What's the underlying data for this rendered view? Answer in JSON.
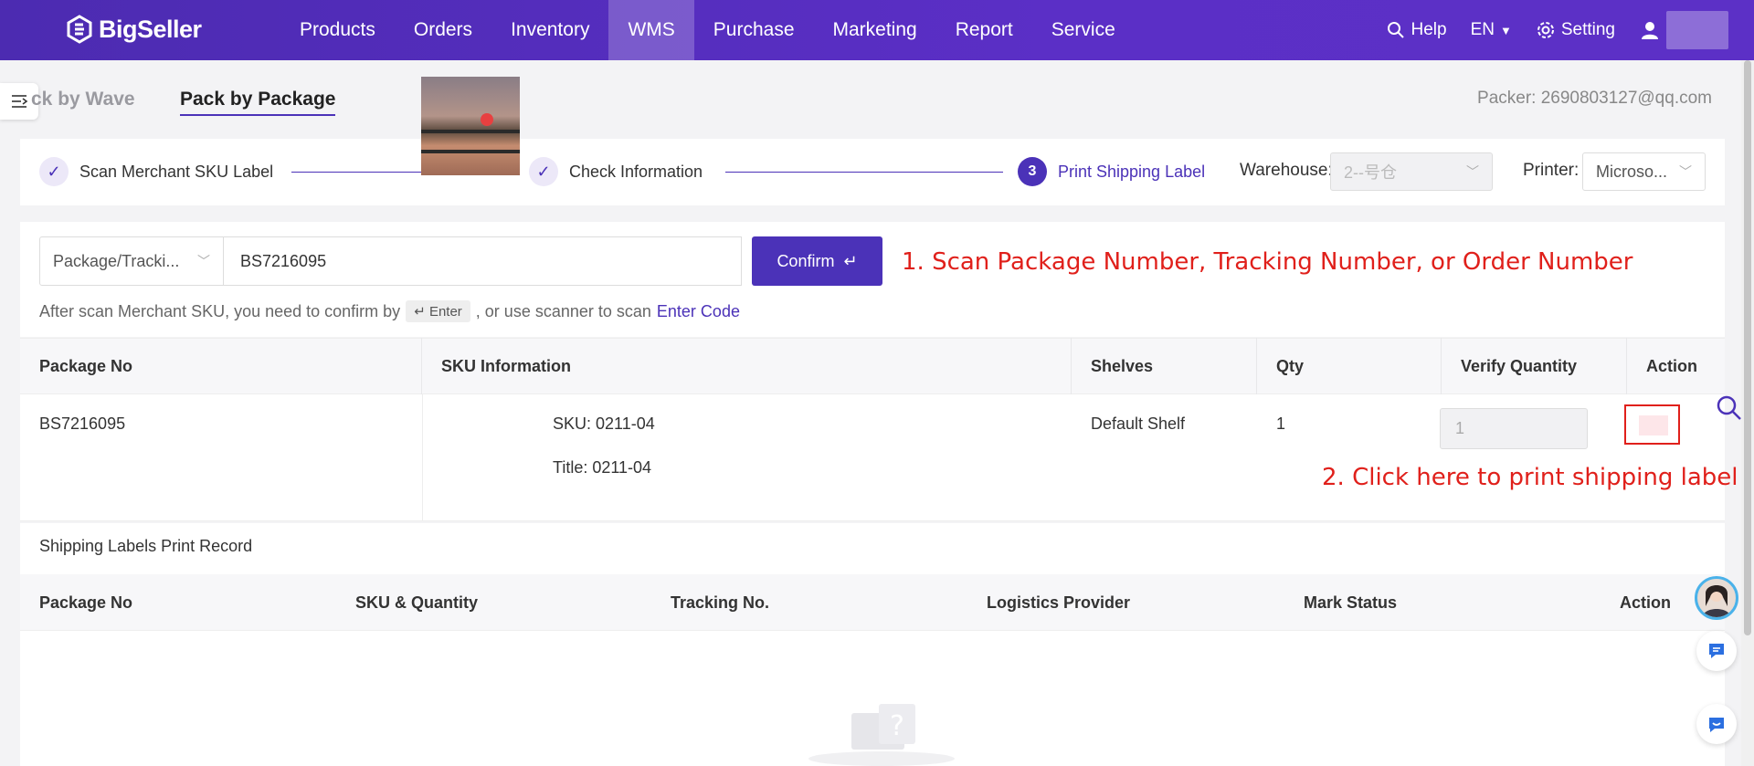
{
  "header": {
    "brand": "BigSeller",
    "nav": [
      "Products",
      "Orders",
      "Inventory",
      "WMS",
      "Purchase",
      "Marketing",
      "Report",
      "Service"
    ],
    "active_nav": "WMS",
    "help": "Help",
    "lang": "EN",
    "setting": "Setting"
  },
  "tabs": {
    "wave": "ck by Wave",
    "package": "Pack by Package"
  },
  "packer": "Packer: 2690803127@qq.com",
  "steps": {
    "step1": "Scan Merchant SKU Label",
    "step2": "Check Information",
    "step3_num": "3",
    "step3": "Print Shipping Label"
  },
  "warehouse": {
    "label": "Warehouse:",
    "value": "2--号仓"
  },
  "printer": {
    "label": "Printer:",
    "value": "Microso..."
  },
  "scan": {
    "type": "Package/Tracki...",
    "value": "BS7216095",
    "confirm": "Confirm",
    "hint_pre": "After scan Merchant SKU, you need to confirm by",
    "hint_key": "Enter",
    "hint_mid": ", or use scanner to scan",
    "hint_link": "Enter Code"
  },
  "annotations": {
    "a1": "1. Scan Package Number, Tracking Number, or Order Number",
    "a2": "2. Click here to print shipping label"
  },
  "package_table": {
    "headers": [
      "Package No",
      "SKU Information",
      "Shelves",
      "Qty",
      "Verify Quantity",
      "Action"
    ],
    "row": {
      "package_no": "BS7216095",
      "sku": "SKU: 0211-04",
      "title": "Title: 0211-04",
      "shelf": "Default Shelf",
      "qty": "1",
      "verify": "1"
    }
  },
  "record": {
    "title": "Shipping Labels Print Record",
    "headers": [
      "Package No",
      "SKU & Quantity",
      "Tracking No.",
      "Logistics Provider",
      "Mark Status",
      "Action"
    ]
  },
  "colors": {
    "brand": "#4b32b8",
    "annotation": "#e0201b"
  }
}
